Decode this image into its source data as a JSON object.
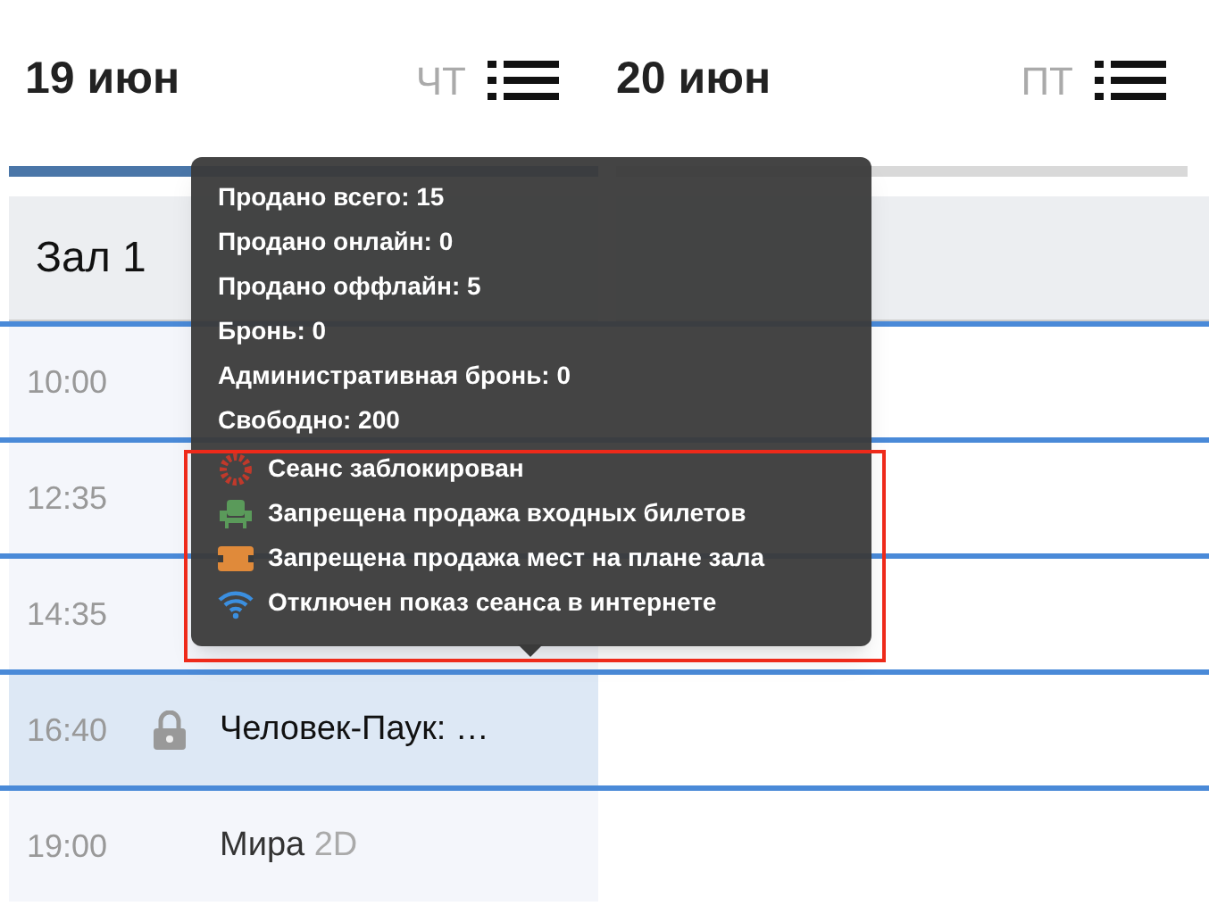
{
  "days": [
    {
      "date": "19 июн",
      "weekday": "ЧТ",
      "selected": true
    },
    {
      "date": "20 июн",
      "weekday": "ПТ",
      "selected": false
    }
  ],
  "hall": {
    "name": "Зал 1"
  },
  "sessions": [
    {
      "time": "10:00",
      "locked": false,
      "selected": false
    },
    {
      "time": "12:35",
      "locked": false,
      "selected": false
    },
    {
      "time": "14:35",
      "locked": false,
      "selected": false
    },
    {
      "time": "16:40",
      "title": "Человек-Паук: …",
      "locked": true,
      "selected": true
    },
    {
      "time": "19:00",
      "title": "Мира",
      "format": "2D",
      "locked": false,
      "selected": false
    }
  ],
  "tooltip": {
    "stats": [
      "Продано всего: 15",
      "Продано онлайн: 0",
      "Продано оффлайн: 5",
      "Бронь: 0",
      "Административная бронь: 0",
      "Свободно: 200"
    ],
    "flags": [
      {
        "kind": "blocked",
        "label": "Сеанс заблокирован"
      },
      {
        "kind": "tickets",
        "label": "Запрещена продажа входных билетов"
      },
      {
        "kind": "seats",
        "label": "Запрещена продажа мест на плане зала"
      },
      {
        "kind": "online",
        "label": "Отключен показ сеанса в интернете"
      }
    ]
  }
}
